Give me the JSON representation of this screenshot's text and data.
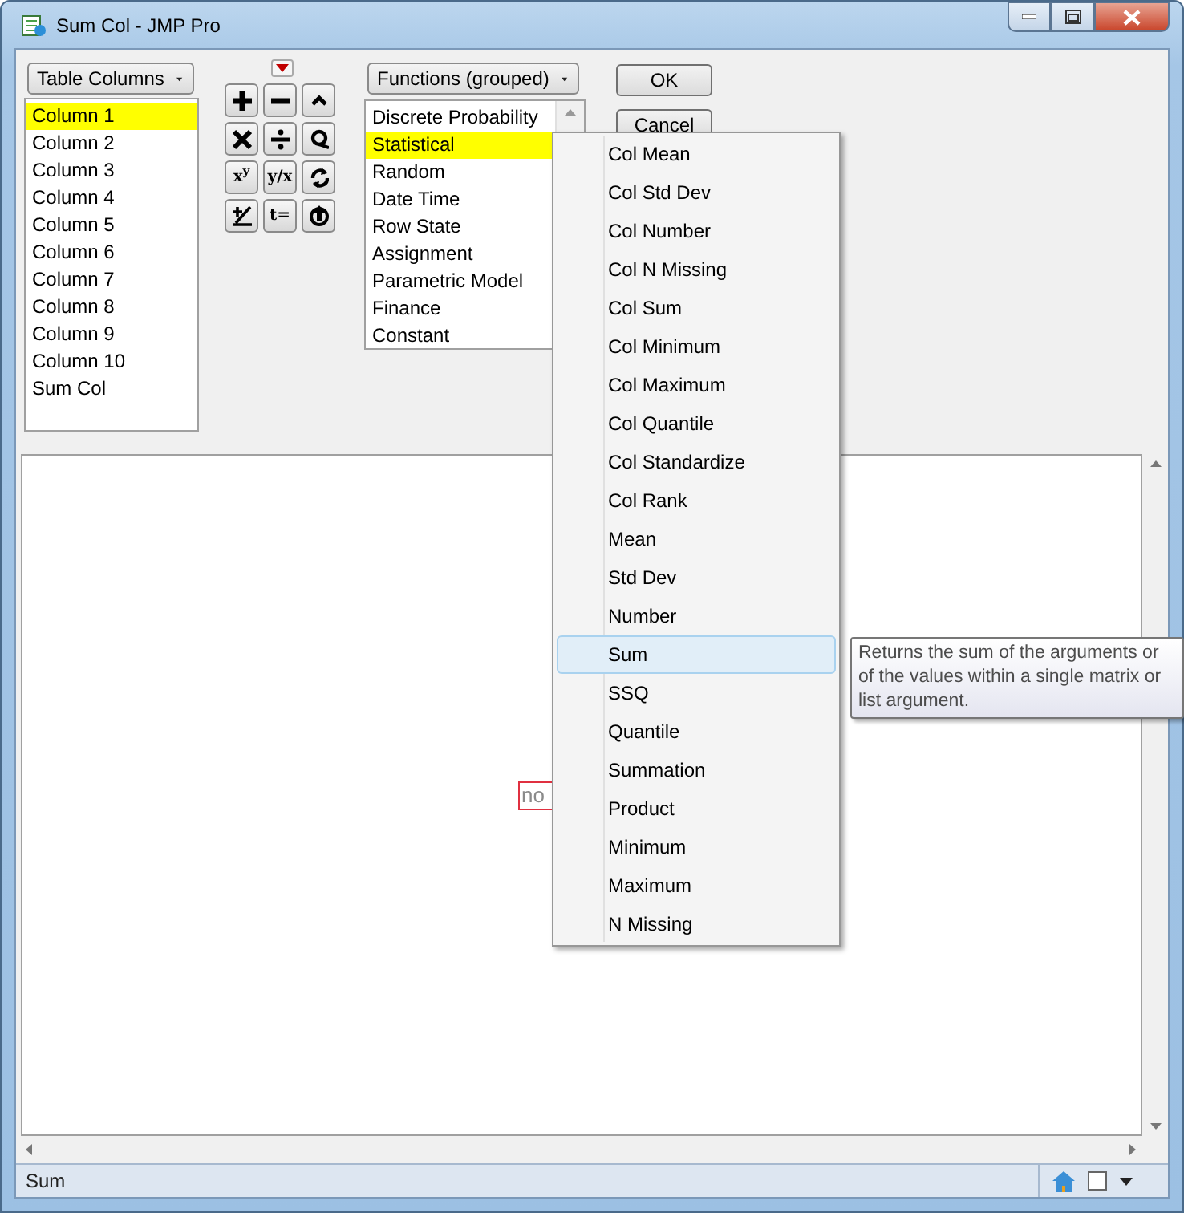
{
  "window": {
    "title": "Sum Col - JMP Pro"
  },
  "columns_dropdown": {
    "label": "Table Columns"
  },
  "columns": [
    {
      "label": "Column 1",
      "selected": true
    },
    {
      "label": "Column 2",
      "selected": false
    },
    {
      "label": "Column 3",
      "selected": false
    },
    {
      "label": "Column 4",
      "selected": false
    },
    {
      "label": "Column 5",
      "selected": false
    },
    {
      "label": "Column 6",
      "selected": false
    },
    {
      "label": "Column 7",
      "selected": false
    },
    {
      "label": "Column 8",
      "selected": false
    },
    {
      "label": "Column 9",
      "selected": false
    },
    {
      "label": "Column 10",
      "selected": false
    },
    {
      "label": "Sum Col",
      "selected": false
    }
  ],
  "keypad": [
    {
      "kind": "plus"
    },
    {
      "kind": "minus"
    },
    {
      "kind": "caret"
    },
    {
      "kind": "times"
    },
    {
      "kind": "divide"
    },
    {
      "kind": "loop"
    },
    {
      "kind": "text",
      "label": "x$^{y}$"
    },
    {
      "kind": "text",
      "label": "y/x"
    },
    {
      "kind": "refresh"
    },
    {
      "kind": "plusminus"
    },
    {
      "kind": "text",
      "label": "t="
    },
    {
      "kind": "upcircle"
    }
  ],
  "functions_dropdown": {
    "label": "Functions (grouped)"
  },
  "functions": [
    {
      "label": "Discrete Probability",
      "selected": false
    },
    {
      "label": "Statistical",
      "selected": true
    },
    {
      "label": "Random",
      "selected": false
    },
    {
      "label": "Date Time",
      "selected": false
    },
    {
      "label": "Row State",
      "selected": false
    },
    {
      "label": "Assignment",
      "selected": false
    },
    {
      "label": "Parametric Model",
      "selected": false
    },
    {
      "label": "Finance",
      "selected": false
    },
    {
      "label": "Constant",
      "selected": false
    }
  ],
  "buttons": [
    "OK",
    "Cancel"
  ],
  "formula": {
    "placeholder": "no"
  },
  "menu": [
    {
      "label": "Col Mean",
      "selected": false
    },
    {
      "label": "Col Std Dev",
      "selected": false
    },
    {
      "label": "Col Number",
      "selected": false
    },
    {
      "label": "Col N Missing",
      "selected": false
    },
    {
      "label": "Col Sum",
      "selected": false
    },
    {
      "label": "Col Minimum",
      "selected": false
    },
    {
      "label": "Col Maximum",
      "selected": false
    },
    {
      "label": "Col Quantile",
      "selected": false
    },
    {
      "label": "Col Standardize",
      "selected": false
    },
    {
      "label": "Col Rank",
      "selected": false
    },
    {
      "label": "Mean",
      "selected": false
    },
    {
      "label": "Std Dev",
      "selected": false
    },
    {
      "label": "Number",
      "selected": false
    },
    {
      "label": "Sum",
      "selected": true
    },
    {
      "label": "SSQ",
      "selected": false
    },
    {
      "label": "Quantile",
      "selected": false
    },
    {
      "label": "Summation",
      "selected": false
    },
    {
      "label": "Product",
      "selected": false
    },
    {
      "label": "Minimum",
      "selected": false
    },
    {
      "label": "Maximum",
      "selected": false
    },
    {
      "label": "N Missing",
      "selected": false
    }
  ],
  "tooltip": "Returns the sum of the arguments or of the values within a single matrix or list argument.",
  "status_bar": {
    "text": "Sum"
  }
}
